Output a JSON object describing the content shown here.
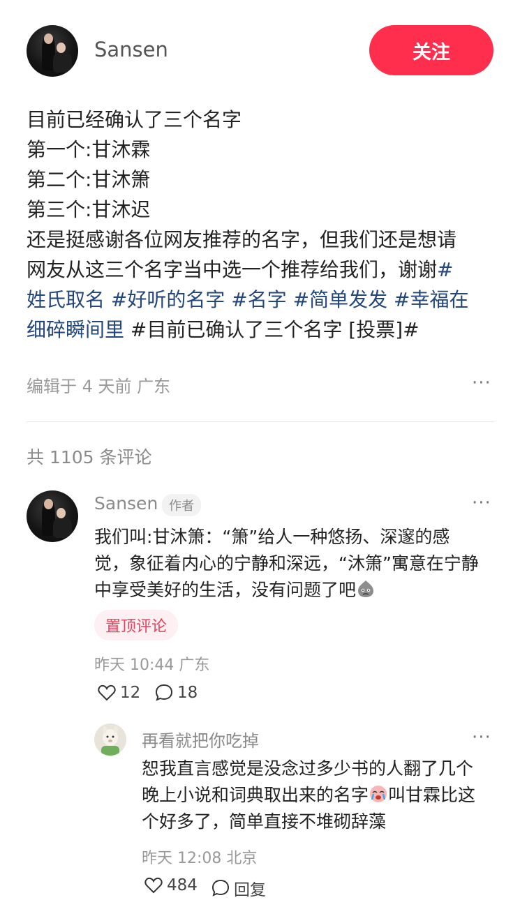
{
  "header": {
    "username": "Sansen",
    "follow_label": "关注"
  },
  "post": {
    "lines": [
      "目前已经确认了三个名字",
      "第一个:甘沐霖",
      "第二个:甘沐箫",
      "第三个:甘沐迟",
      "还是挺感谢各位网友推荐的名字，但我们还是想请",
      "网友从这三个名字当中选一个推荐给我们，谢谢"
    ],
    "tags": {
      "t1_start": "#",
      "t1_end": "姓氏取名",
      "t2": "#好听的名字",
      "t3": "#名字",
      "t4": "#简单发发",
      "t5_start": "#幸福在",
      "t5_end": "细碎瞬间里",
      "t6": "#目前已确认了三个名字 [投票]#"
    },
    "meta": "编辑于 4 天前 广东",
    "more": "···"
  },
  "comments_count": "共 1105 条评论",
  "comment": {
    "username": "Sansen",
    "badge": "作者",
    "more": "···",
    "lines": [
      "我们叫:甘沐箫：“箫”给人一种悠扬、深邃的感",
      "觉，象征着内心的宁静和深远，“沐箫”寓意在宁静",
      "中享受美好的生活，没有问题了吧"
    ],
    "pin_label": "置顶评论",
    "meta": "昨天 10:44 广东",
    "likes": "12",
    "replies": "18"
  },
  "reply": {
    "username": "再看就把你吃掉",
    "more": "···",
    "lines": [
      "恕我直言感觉是没念过多少书的人翻了几个",
      "晚上小说和词典取出来的名字",
      "叫甘霖比这",
      "个好多了，简单直接不堆砌辞藻"
    ],
    "meta": "昨天 12:08 北京",
    "likes": "484",
    "reply_label": "回复"
  },
  "colors": {
    "accent": "#ff2e4d",
    "tag": "#23467b",
    "pin_text": "#e5455e"
  }
}
